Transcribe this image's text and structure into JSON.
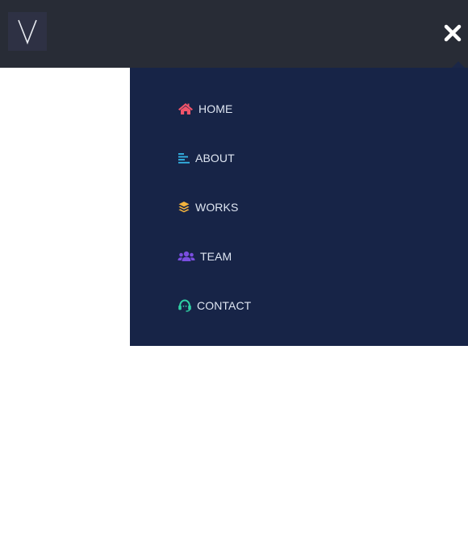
{
  "header": {
    "logo_icon": "v-logo-icon",
    "close_icon": "close-icon"
  },
  "menu": {
    "items": [
      {
        "label": "HOME",
        "icon": "home-icon",
        "color": "#f2546a"
      },
      {
        "label": "ABOUT",
        "icon": "align-left-icon",
        "color": "#35b7e8"
      },
      {
        "label": "WORKS",
        "icon": "layers-icon",
        "color": "#f3b33d"
      },
      {
        "label": "TEAM",
        "icon": "users-icon",
        "color": "#7a4ee0"
      },
      {
        "label": "CONTACT",
        "icon": "headset-icon",
        "color": "#2fd1a4"
      }
    ]
  },
  "colors": {
    "header_bg": "#282c36",
    "panel_bg": "#172447",
    "page_bg": "#ffffff"
  }
}
